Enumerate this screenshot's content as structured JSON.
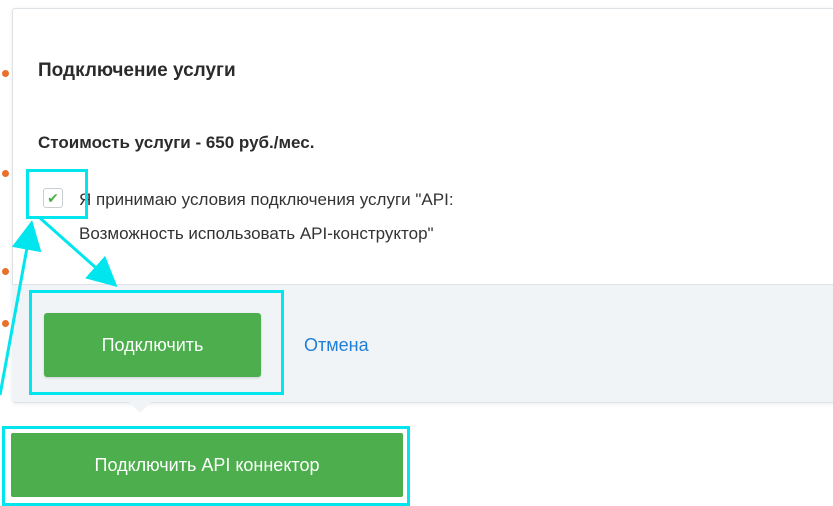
{
  "popover": {
    "title": "Подключение услуги",
    "price": "Стоимость услуги - 650 руб./мес.",
    "terms_line1": "Я принимаю условия подключения услуги \"API:",
    "terms_line2": "Возможность использовать API-конструктор\"",
    "checkbox_checked": true,
    "connect_label": "Подключить",
    "cancel_label": "Отмена"
  },
  "trigger": {
    "connect_api_label": "Подключить API коннектор"
  },
  "colors": {
    "accent_green": "#4cae4c",
    "link_blue": "#1f7fd6",
    "highlight": "#00e5ee"
  },
  "icons": {
    "checkbox": "check-icon"
  }
}
